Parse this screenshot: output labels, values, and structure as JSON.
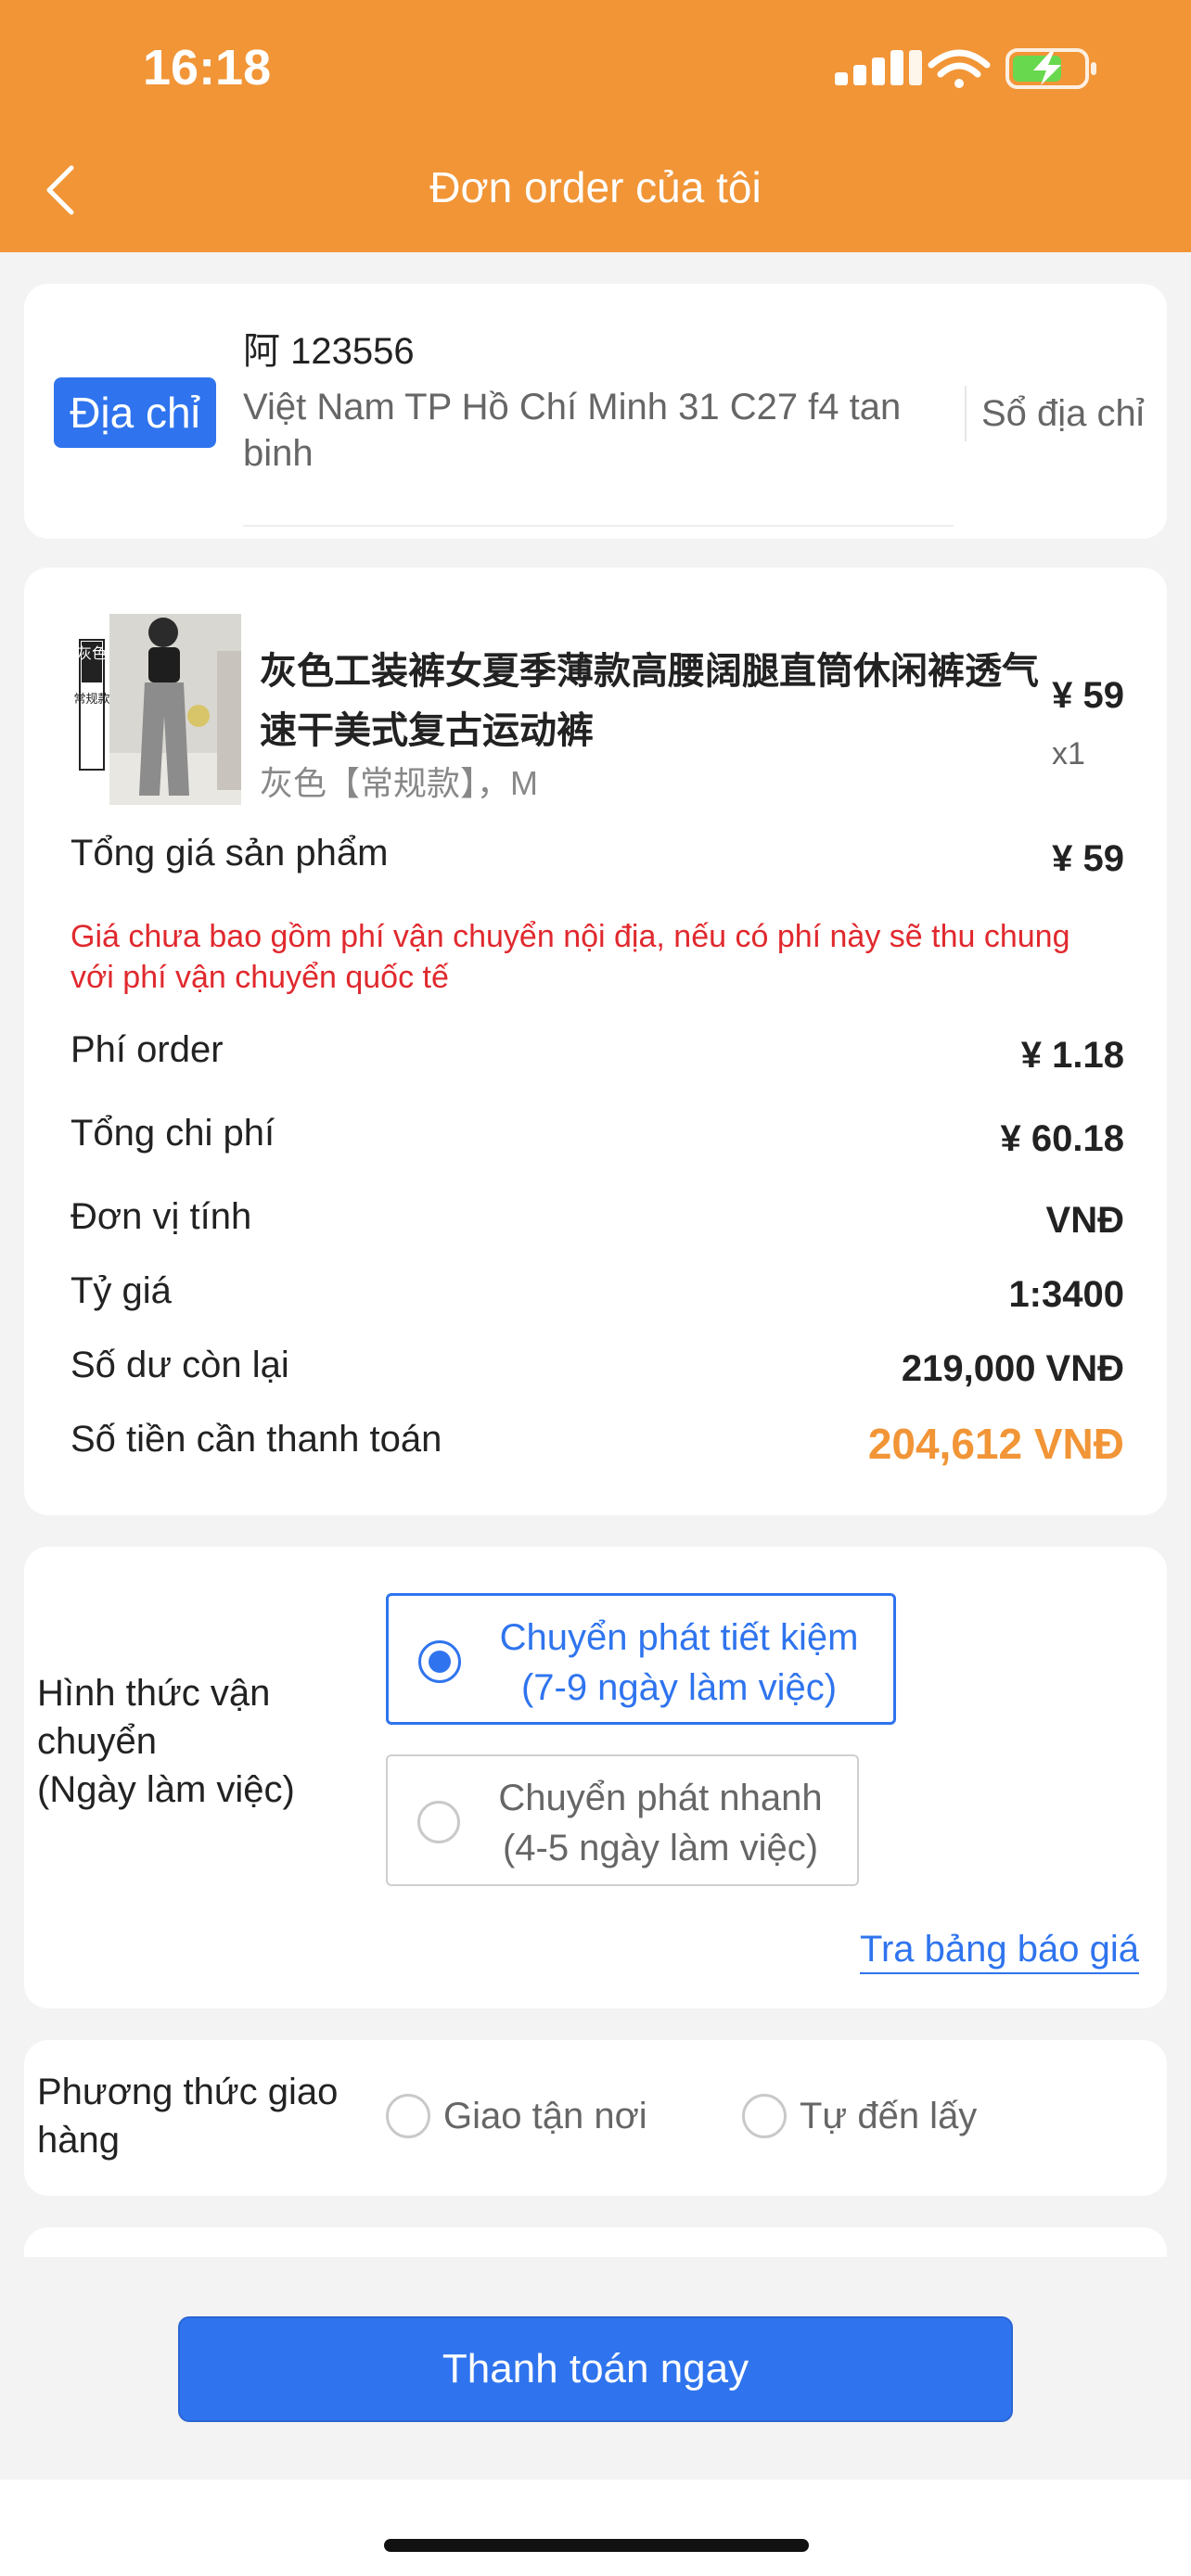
{
  "status_bar": {
    "time": "16:18"
  },
  "header": {
    "title": "Đơn order của tôi"
  },
  "address": {
    "badge": "Địa chỉ",
    "name": "阿 123556",
    "text": "Việt Nam TP Hồ Chí Minh 31 C27 f4 tan binh",
    "book_link": "Sổ địa chỉ"
  },
  "product": {
    "image_tag_1": "灰色",
    "image_tag_2": "常规款",
    "name": "灰色工装裤女夏季薄款高腰阔腿直筒休闲裤透气速干美式复古运动裤",
    "variant": "灰色【常规款】，M",
    "price": "¥ 59",
    "qty": "x1"
  },
  "summary": {
    "subtotal_label": "Tổng giá sản phẩm",
    "subtotal_value": "¥ 59",
    "notice": "Giá chưa bao gồm phí vận chuyển nội địa, nếu có phí này sẽ thu chung với phí vận chuyển quốc tế",
    "order_fee_label": "Phí order",
    "order_fee_value": "¥ 1.18",
    "total_cost_label": "Tổng chi phí",
    "total_cost_value": "¥ 60.18",
    "unit_label": "Đơn vị tính",
    "unit_value": "VNĐ",
    "rate_label": "Tỷ giá",
    "rate_value": "1:3400",
    "balance_label": "Số dư còn lại",
    "balance_value": "219,000 VNĐ",
    "pay_amount_label": "Số tiền cần thanh toán",
    "pay_amount_value": "204,612 VNĐ"
  },
  "shipping": {
    "label_line1": "Hình thức vận",
    "label_line2": "chuyển",
    "label_line3": "(Ngày làm việc)",
    "options": [
      {
        "line1": "Chuyển phát tiết kiệm",
        "line2": "(7-9 ngày làm việc)",
        "selected": true
      },
      {
        "line1": "Chuyển phát nhanh",
        "line2": "(4-5 ngày làm việc)",
        "selected": false
      }
    ],
    "price_table_link": "Tra bảng báo giá"
  },
  "delivery": {
    "label_line1": "Phương thức giao",
    "label_line2": "hàng",
    "options": [
      "Giao tận nơi",
      "Tự đến lấy"
    ]
  },
  "pay_button": "Thanh toán ngay",
  "colors": {
    "brand_orange": "#f19537",
    "primary_blue": "#2f74ee",
    "notice_red": "#e0292e"
  }
}
